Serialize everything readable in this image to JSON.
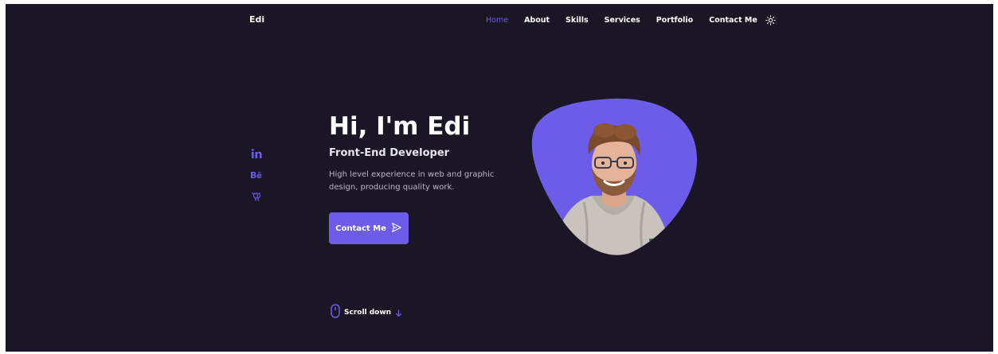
{
  "header": {
    "logo": "Edi",
    "nav": [
      "Home",
      "About",
      "Skills",
      "Services",
      "Portfolio",
      "Contact Me"
    ],
    "active": "Home",
    "theme_icon": "sun-icon"
  },
  "social": [
    "linkedin-icon",
    "behance-icon",
    "github-icon"
  ],
  "hero": {
    "title": "Hi, I'm Edi",
    "subtitle": "Front-End Developer",
    "description": "High level experience in web and graphic design, producing quality work.",
    "cta_label": "Contact Me",
    "cta_icon": "send-icon"
  },
  "scroll": {
    "label": "Scroll down",
    "icons": [
      "mouse-icon",
      "arrow-down-icon"
    ]
  },
  "colors": {
    "background": "#1b1625",
    "accent": "#6c5ce7",
    "text": "#ffffff",
    "muted": "#b9b6c6"
  }
}
